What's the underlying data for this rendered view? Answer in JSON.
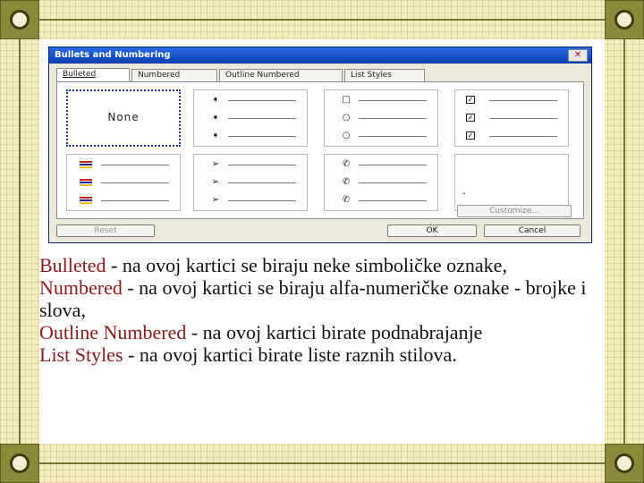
{
  "dialog": {
    "title": "Bullets and Numbering",
    "close_label": "✕",
    "tabs": [
      {
        "label": "Bulleted",
        "active": true
      },
      {
        "label": "Numbered",
        "active": false
      },
      {
        "label": "Outline Numbered",
        "active": false
      },
      {
        "label": "List Styles",
        "active": false
      }
    ],
    "none_label": "None",
    "bullet_symbols": {
      "cell2": [
        "➧",
        "➧",
        "➧"
      ],
      "cell3": [
        "□",
        "○",
        "○"
      ],
      "cell6": [
        "➢",
        "➢",
        "➢"
      ],
      "cell7": [
        "✆",
        "✆",
        "✆"
      ],
      "check_mark": "✓",
      "dash": "-"
    },
    "customize_label": "Customize...",
    "reset_label": "Reset",
    "ok_label": "OK",
    "cancel_label": "Cancel"
  },
  "description": [
    {
      "keyword": "Bulleted",
      "text": " - na ovoj kartici se biraju neke simboličke oznake,"
    },
    {
      "keyword": "Numbered",
      "text": " - na ovoj kartici se biraju alfa-numeričke oznake - brojke i slova,"
    },
    {
      "keyword": "Outline Numbered",
      "text": " - na ovoj kartici birate podnabrajanje"
    },
    {
      "keyword": "List Styles",
      "text": " - na ovoj kartici birate liste raznih stilova."
    }
  ],
  "colors": {
    "keyword": "#8b1a1a",
    "titlebar": "#0b3fb5",
    "border_olive": "#7a7432"
  }
}
